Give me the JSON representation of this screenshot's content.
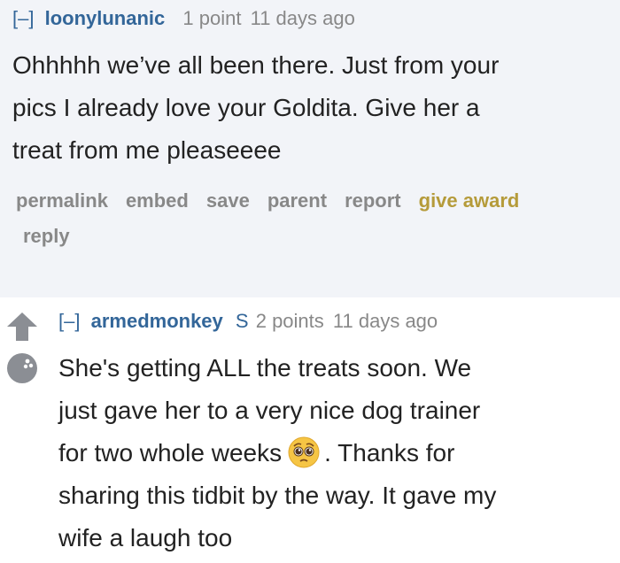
{
  "comment1": {
    "collapse": "[–]",
    "author": "loonylunanic",
    "score": "1 point",
    "time": "11 days ago",
    "lines": [
      "Ohhhhh we’ve all been there. Just from your",
      "pics I already love your Goldita. Give her a",
      "treat from me pleaseeee"
    ],
    "buttons": {
      "permalink": "permalink",
      "embed": "embed",
      "save": "save",
      "parent": "parent",
      "report": "report",
      "give_award": "give award",
      "reply": "reply"
    }
  },
  "comment2": {
    "collapse": "[–]",
    "author": "armedmonkey",
    "submitter_flag": "S",
    "score": "2 points",
    "time": "11 days ago",
    "lines": [
      "She's getting ALL the treats soon. We",
      "just gave her to a very nice dog trainer",
      "for two whole weeks",
      ". Thanks for",
      "sharing this tidbit by the way. It gave my",
      "wife a laugh too"
    ],
    "emoji": "pleading-face-emoji"
  },
  "colors": {
    "link_blue": "#336699",
    "meta_gray": "#888888",
    "award_gold": "#b59b3a",
    "comment_bg": "#f2f4f8",
    "vote_gray": "#8b8e94"
  }
}
